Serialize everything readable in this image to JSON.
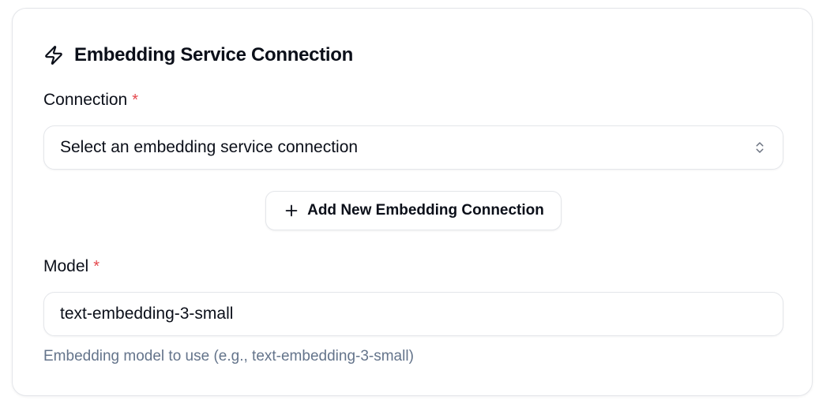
{
  "card": {
    "title": "Embedding Service Connection",
    "title_icon": "zap-icon"
  },
  "connection": {
    "label": "Connection",
    "required_mark": "*",
    "select_value": "Select an embedding service connection",
    "select_icon": "chevron-up-down-icon"
  },
  "add_connection": {
    "label": "Add New Embedding Connection",
    "icon": "plus-icon"
  },
  "model": {
    "label": "Model",
    "required_mark": "*",
    "value": "text-embedding-3-small",
    "helper": "Embedding model to use (e.g., text-embedding-3-small)"
  },
  "colors": {
    "required": "#e5484d",
    "helper_text": "#64748b",
    "border": "#e4e6ea"
  }
}
